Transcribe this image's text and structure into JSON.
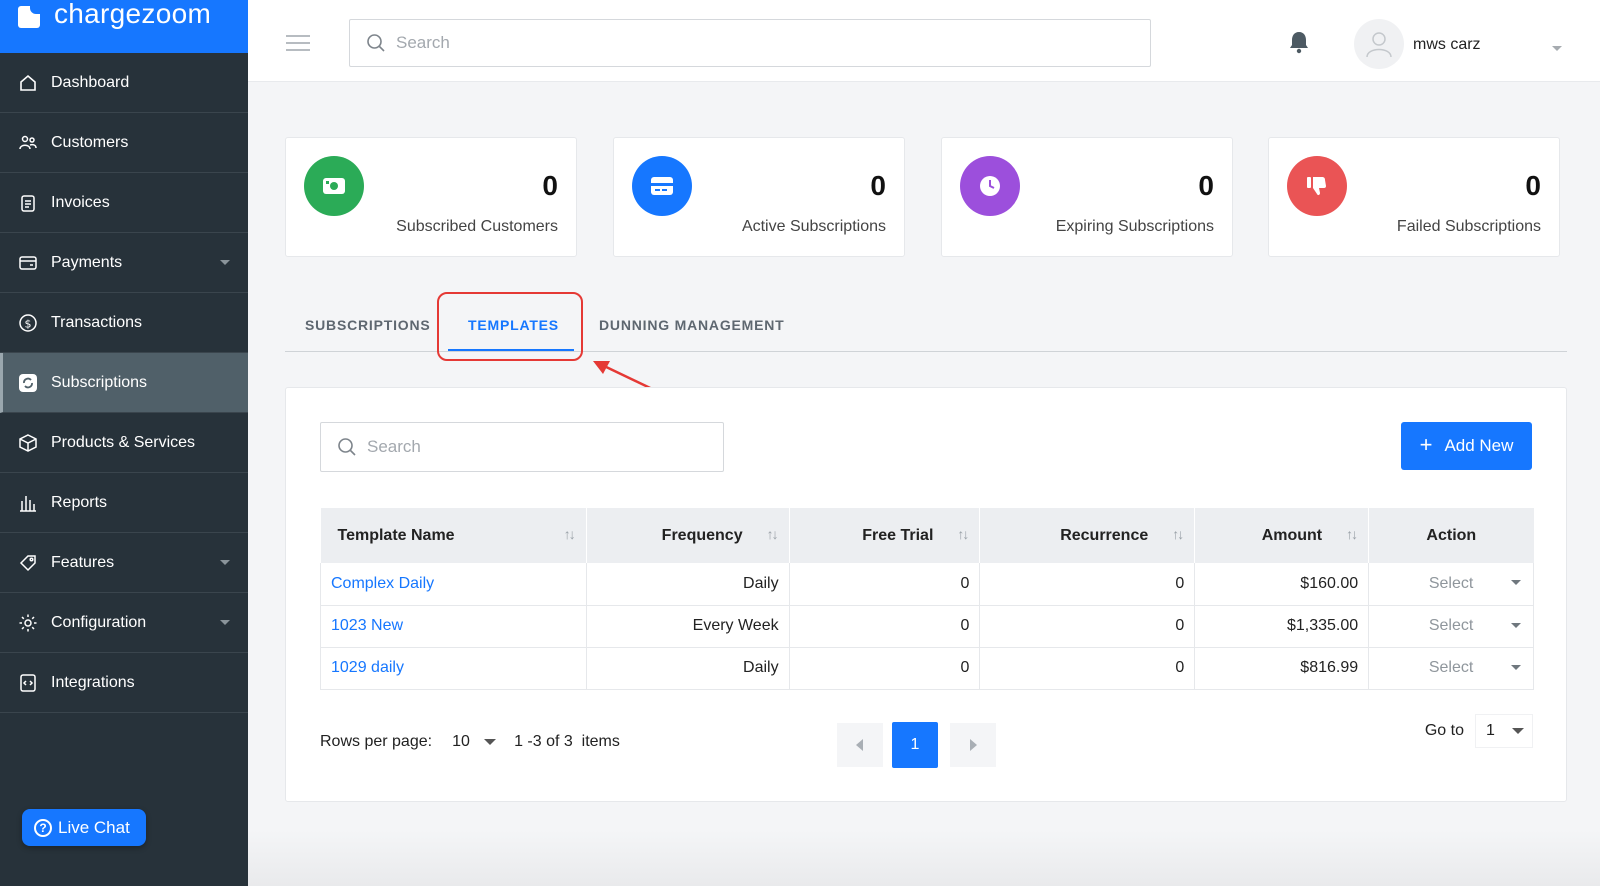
{
  "app": {
    "logo_text": "chargezoom"
  },
  "sidebar": {
    "items": [
      {
        "label": "Dashboard",
        "icon": "home-icon"
      },
      {
        "label": "Customers",
        "icon": "users-icon"
      },
      {
        "label": "Invoices",
        "icon": "clipboard-icon"
      },
      {
        "label": "Payments",
        "icon": "wallet-icon",
        "has_submenu": true
      },
      {
        "label": "Transactions",
        "icon": "dollar-circle-icon"
      },
      {
        "label": "Subscriptions",
        "icon": "refresh-icon",
        "active": true
      },
      {
        "label": "Products & Services",
        "icon": "box-icon"
      },
      {
        "label": "Reports",
        "icon": "bar-chart-icon"
      },
      {
        "label": "Features",
        "icon": "tag-icon",
        "has_submenu": true
      },
      {
        "label": "Configuration",
        "icon": "gear-icon",
        "has_submenu": true
      },
      {
        "label": "Integrations",
        "icon": "code-icon"
      }
    ],
    "live_chat": "Live Chat"
  },
  "header": {
    "search_placeholder": "Search",
    "user_name": "mws carz"
  },
  "stats": [
    {
      "count": "0",
      "label": "Subscribed Customers",
      "color": "#2bab57",
      "icon": "money-icon"
    },
    {
      "count": "0",
      "label": "Active Subscriptions",
      "color": "#1677ff",
      "icon": "card-icon"
    },
    {
      "count": "0",
      "label": "Expiring Subscriptions",
      "color": "#9c4fdc",
      "icon": "clock-icon"
    },
    {
      "count": "0",
      "label": "Failed Subscriptions",
      "color": "#ea5455",
      "icon": "thumbs-down-icon"
    }
  ],
  "tabs": [
    {
      "label": "SUBSCRIPTIONS"
    },
    {
      "label": "TEMPLATES",
      "active": true
    },
    {
      "label": "DUNNING MANAGEMENT"
    }
  ],
  "templates": {
    "search_placeholder": "Search",
    "add_label": "Add New",
    "columns": [
      "Template Name",
      "Frequency",
      "Free Trial",
      "Recurrence",
      "Amount",
      "Action"
    ],
    "rows": [
      {
        "name": "Complex Daily",
        "frequency": "Daily",
        "free_trial": "0",
        "recurrence": "0",
        "amount": "$160.00",
        "action": "Select"
      },
      {
        "name": "1023 New",
        "frequency": "Every Week",
        "free_trial": "0",
        "recurrence": "0",
        "amount": "$1,335.00",
        "action": "Select"
      },
      {
        "name": "1029 daily",
        "frequency": "Daily",
        "free_trial": "0",
        "recurrence": "0",
        "amount": "$816.99",
        "action": "Select"
      }
    ],
    "pager": {
      "rows_label": "Rows per page:",
      "rows_value": "10",
      "items_text": "1 -3 of 3  items",
      "current_page": "1",
      "goto_label": "Go to",
      "goto_value": "1"
    }
  },
  "colors": {
    "brand": "#1677ff",
    "sidebar": "#27323a",
    "annotation": "#e53935"
  }
}
